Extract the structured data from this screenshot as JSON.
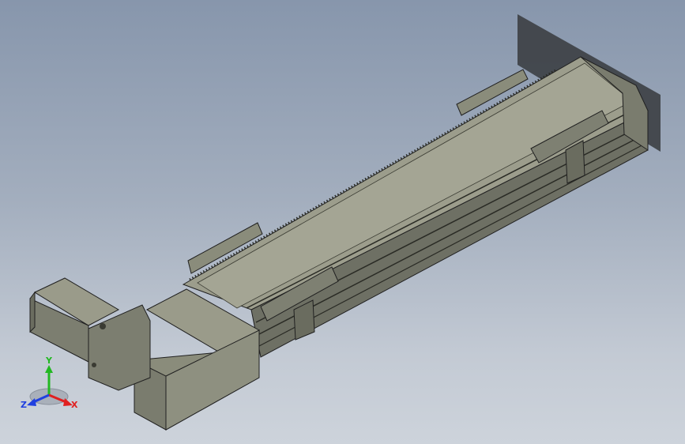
{
  "viewport": {
    "background_top": "#8796ac",
    "background_bottom": "#cdd3db"
  },
  "model": {
    "body_color": "#8a8c7b",
    "top_color": "#9c9d8c",
    "dark_color": "#5b5d50",
    "edge_color": "#202020",
    "shadow_color": "#3c3f44"
  },
  "triad": {
    "y_label": "Y",
    "x_label": "X",
    "z_label": "Z",
    "y_color": "#22b822",
    "x_color": "#e02020",
    "z_color": "#2040e0"
  }
}
